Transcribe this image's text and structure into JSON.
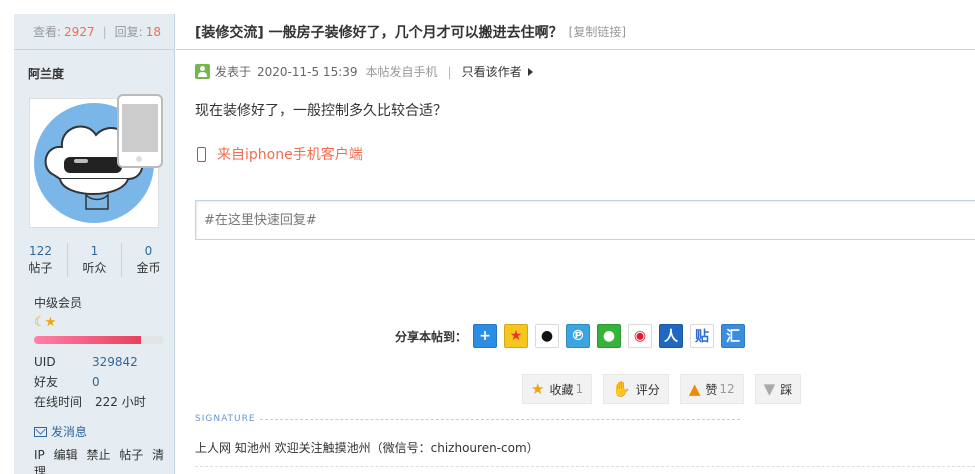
{
  "sidebar": {
    "views_label": "查看:",
    "views": "2927",
    "replies_label": "回复:",
    "replies": "18",
    "author_name": "阿兰度",
    "counts": [
      {
        "value": "122",
        "label": "帖子"
      },
      {
        "value": "1",
        "label": "听众"
      },
      {
        "value": "0",
        "label": "金币"
      }
    ],
    "group": "中级会员",
    "medal_icons": [
      "moon-icon",
      "star-icon"
    ],
    "credit_progress": 0.82,
    "info": {
      "uid_label": "UID",
      "uid": "329842",
      "friends_label": "好友",
      "friends": "0",
      "online_label": "在线时间",
      "online": "222 小时"
    },
    "send_message": "发消息",
    "admin_links": [
      "IP",
      "编辑",
      "禁止",
      "帖子",
      "清理"
    ]
  },
  "post": {
    "title": "[装修交流] 一般房子装修好了，几个月才可以搬进去住啊？",
    "copy_link": "[复制链接]",
    "posted_label": "发表于",
    "posted_time": "2020-11-5 15:39",
    "mobile_note": "本帖发自手机",
    "pipe": "|",
    "only_author": "只看该作者",
    "content": "现在装修好了，一般控制多久比较合适？",
    "from_phone": "来自iphone手机客户端",
    "reply_placeholder": "#在这里快速回复#",
    "share_label": "分享本帖到：",
    "share_icons": [
      "plus-icon",
      "qzone-icon",
      "qq-icon",
      "tencent-weibo-icon",
      "wechat-icon",
      "sina-weibo-icon",
      "renren-icon",
      "baidu-tieba-icon",
      "netease-icon"
    ],
    "actions": {
      "favorite_label": "收藏",
      "favorite_count": "1",
      "rate_label": "评分",
      "like_label": "赞",
      "like_count": "12",
      "dislike_label": "踩"
    },
    "signature_label": "SIGNATURE",
    "signature_text": "上人网 知池州 欢迎关注触摸池州（微信号：chizhouren-com）"
  },
  "colors": {
    "sidebar_bg": "#e5edf2",
    "border": "#c2d5e3",
    "link": "#336699",
    "accent": "#f26c4f",
    "credit_bar": "#e8405f"
  }
}
